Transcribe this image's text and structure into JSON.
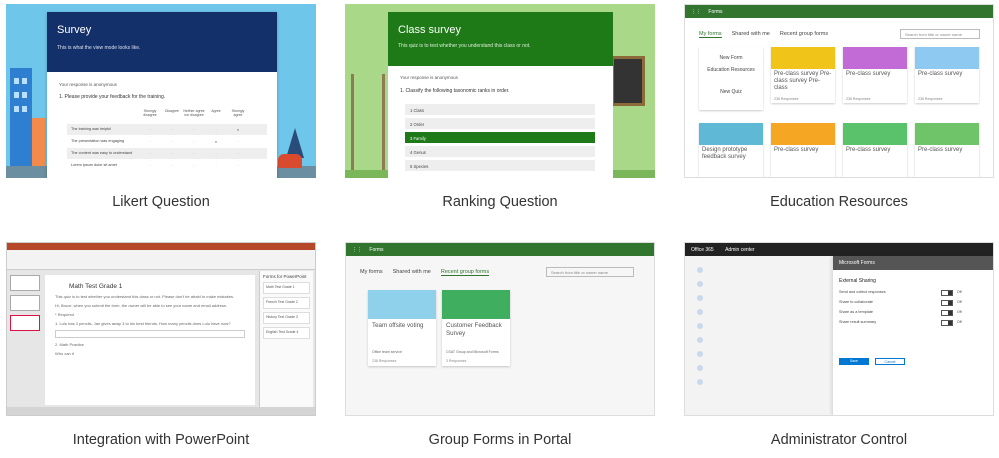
{
  "tiles": {
    "likert": {
      "caption": "Likert Question",
      "title": "Survey",
      "subtitle": "This is what the view mode looks like.",
      "anonymous": "Your response is anonymous",
      "question": "1.  Please provide your feedback for the training.",
      "columns": [
        "Strongly disagree",
        "Disagree",
        "Neither agree nor disagree",
        "Agree",
        "Strongly agree"
      ],
      "rows": [
        "The training was helpful",
        "The presentation was engaging",
        "The content was easy to understand",
        "Lorem ipsum dolor sit amet"
      ],
      "banner_color": "#14306b"
    },
    "ranking": {
      "caption": "Ranking Question",
      "title": "Class survey",
      "subtitle": "This quiz is to test whether you understand this class or not.",
      "anonymous": "Your response is anonymous",
      "question": "1.  Classify the following taxonomic ranks in order.",
      "items": [
        "1   Class",
        "2   Order",
        "3   Family",
        "4   Genus",
        "5   Species"
      ],
      "selected_index": 2,
      "banner_color": "#1e7a17"
    },
    "education": {
      "caption": "Education Resources",
      "app_name": "Forms",
      "tabs": [
        "My forms",
        "Shared with me",
        "Recent group forms"
      ],
      "search_placeholder": "Search from title or owner name",
      "new_items": [
        "New Form",
        "Education Resources",
        "New Quiz"
      ],
      "cards": [
        {
          "label": "Pre-class survey Pre-class survey Pre-class",
          "meta": "238 Responses",
          "color": "#f0c419"
        },
        {
          "label": "Pre-class survey",
          "meta": "238 Responses",
          "color": "#c26ad6"
        },
        {
          "label": "Pre-class survey",
          "meta": "238 Responses",
          "color": "#8dc9f0"
        },
        {
          "label": "Design prototype feedback survey",
          "meta": "",
          "color": "#5fb8d6"
        },
        {
          "label": "Pre-class survey",
          "meta": "",
          "color": "#f5a623"
        },
        {
          "label": "Pre-class survey",
          "meta": "",
          "color": "#59c26a"
        },
        {
          "label": "Pre-class survey",
          "meta": "",
          "color": "#6fc46a"
        }
      ]
    },
    "powerpoint": {
      "caption": "Integration with PowerPoint",
      "doc_title": "Math Test Grade 1",
      "doc_lines": [
        "This quiz is to test whether you understand this class or not. Please don't be afraid to make mistakes.",
        "Hi, Bruce, when you submit the form, the owner will be able to see your name and email address.",
        "* Required",
        "1. Lulu has 3 pencils, Jan gives away 3 to his best friends. How many pencils does Lulu have now?",
        "2. Math Practice",
        "Who can it"
      ],
      "panel_title": "Forms for PowerPoint",
      "panel_items": [
        "Math Test Grade 1",
        "French Test Grade 2",
        "History Test Grade 3",
        "English Test Grade 4"
      ]
    },
    "group": {
      "caption": "Group Forms in Portal",
      "app_name": "Forms",
      "tabs": [
        "My forms",
        "Shared with me",
        "Recent group forms"
      ],
      "search_placeholder": "Search from title or owner name",
      "cards": [
        {
          "label": "Team offsite voting",
          "who": "Office team service",
          "count": "238 Responses",
          "color": "#8fd0ea"
        },
        {
          "label": "Customer Feedback Survey",
          "who": "CSAT Group and Microsoft Forms",
          "count": "3 Responses",
          "color": "#3fae5e"
        }
      ]
    },
    "admin": {
      "caption": "Administrator Control",
      "app_bar": [
        "Office 365",
        "Admin center"
      ],
      "panel_header": "Microsoft Forms",
      "section_title": "External Sharing",
      "options": [
        {
          "label": "Send and collect responses",
          "state": "Off"
        },
        {
          "label": "Share to collaborate",
          "state": "Off"
        },
        {
          "label": "Share as a template",
          "state": "Off"
        },
        {
          "label": "Share result summary",
          "state": "Off"
        }
      ],
      "save_label": "Save",
      "cancel_label": "Cancel"
    }
  }
}
